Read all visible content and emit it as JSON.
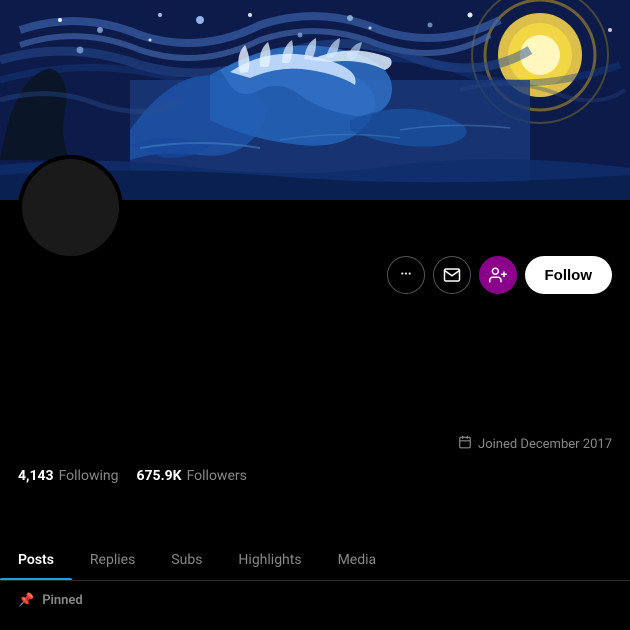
{
  "banner": {
    "alt": "Artistic banner combining Starry Night and Great Wave"
  },
  "avatar": {
    "alt": "User avatar"
  },
  "actions": {
    "more_label": "···",
    "message_label": "✉",
    "add_user_label": "👤",
    "follow_label": "Follow"
  },
  "joined": {
    "icon": "📅",
    "text": "Joined December 2017"
  },
  "stats": {
    "following_count": "4,143",
    "following_label": "Following",
    "followers_count": "675.9K",
    "followers_label": "Followers"
  },
  "tabs": [
    {
      "id": "posts",
      "label": "Posts",
      "active": true
    },
    {
      "id": "replies",
      "label": "Replies",
      "active": false
    },
    {
      "id": "subs",
      "label": "Subs",
      "active": false
    },
    {
      "id": "highlights",
      "label": "Highlights",
      "active": false
    },
    {
      "id": "media",
      "label": "Media",
      "active": false
    }
  ],
  "pinned": {
    "icon": "📌",
    "label": "Pinned"
  }
}
